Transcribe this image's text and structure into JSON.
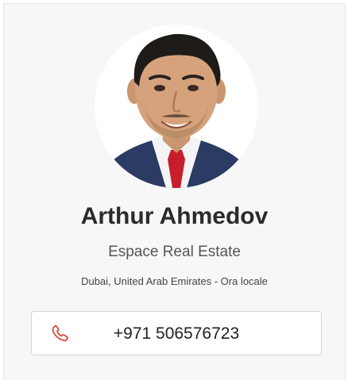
{
  "agent": {
    "name": "Arthur Ahmedov",
    "company": "Espace Real Estate",
    "location": "Dubai, United Arab Emirates - Ora locale",
    "phone": "+971 506576723"
  },
  "icons": {
    "phone": "phone-icon"
  },
  "colors": {
    "phone_icon": "#d9342b",
    "card_background": "#f7f7f7",
    "tie": "#c81d2a",
    "suit": "#2b3b63"
  }
}
